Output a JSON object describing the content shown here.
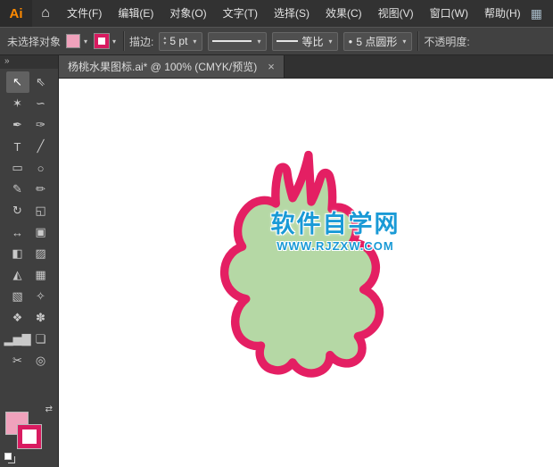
{
  "menubar": {
    "logo_text": "Ai",
    "home_icon": "⌂",
    "items": [
      {
        "name": "file",
        "label": "文件(F)"
      },
      {
        "name": "edit",
        "label": "编辑(E)"
      },
      {
        "name": "object",
        "label": "对象(O)"
      },
      {
        "name": "type",
        "label": "文字(T)"
      },
      {
        "name": "select",
        "label": "选择(S)"
      },
      {
        "name": "effect",
        "label": "效果(C)"
      },
      {
        "name": "view",
        "label": "视图(V)"
      },
      {
        "name": "window",
        "label": "窗口(W)"
      },
      {
        "name": "help",
        "label": "帮助(H)"
      }
    ],
    "panels_icon": "▦"
  },
  "controlbar": {
    "no_selection_label": "未选择对象",
    "fill_color": "#f0a2bc",
    "stroke_color": "#d81b60",
    "chevron_icon": "▾",
    "stroke_label": "描边:",
    "stepper_up_icon": "▴",
    "stepper_down_icon": "▾",
    "stroke_weight_value": "5 pt",
    "width_profile_value": "等比",
    "brush_dot_icon": "●",
    "brush_value": "5 点圆形",
    "opacity_label": "不透明度:"
  },
  "tabbar": {
    "title": "杨桃水果图标.ai* @ 100% (CMYK/预览)",
    "close_icon": "×"
  },
  "toolbar": {
    "collapse_icon": "»",
    "swap_icon": "⇄",
    "fill_color": "#f0a2bc",
    "stroke_color": "#d81b60",
    "tools": [
      {
        "name": "selection-tool",
        "glyph": "↖",
        "selected": true
      },
      {
        "name": "direct-selection-tool",
        "glyph": "⇖"
      },
      {
        "name": "magic-wand-tool",
        "glyph": "✶"
      },
      {
        "name": "lasso-tool",
        "glyph": "∽"
      },
      {
        "name": "pen-tool",
        "glyph": "✒"
      },
      {
        "name": "curvature-tool",
        "glyph": "✑"
      },
      {
        "name": "type-tool",
        "glyph": "T"
      },
      {
        "name": "line-segment-tool",
        "glyph": "╱"
      },
      {
        "name": "rectangle-tool",
        "glyph": "▭"
      },
      {
        "name": "ellipse-tool",
        "glyph": "○"
      },
      {
        "name": "paintbrush-tool",
        "glyph": "✎"
      },
      {
        "name": "pencil-tool",
        "glyph": "✏"
      },
      {
        "name": "rotate-tool",
        "glyph": "↻"
      },
      {
        "name": "scale-tool",
        "glyph": "◱"
      },
      {
        "name": "width-tool",
        "glyph": "↔"
      },
      {
        "name": "free-transform-tool",
        "glyph": "▣"
      },
      {
        "name": "shape-builder-tool",
        "glyph": "◧"
      },
      {
        "name": "live-paint-bucket-tool",
        "glyph": "▨"
      },
      {
        "name": "perspective-grid-tool",
        "glyph": "◭"
      },
      {
        "name": "mesh-tool",
        "glyph": "▦"
      },
      {
        "name": "gradient-tool",
        "glyph": "▧"
      },
      {
        "name": "eyedropper-tool",
        "glyph": "✧"
      },
      {
        "name": "blend-tool",
        "glyph": "❖"
      },
      {
        "name": "symbol-sprayer-tool",
        "glyph": "✽"
      },
      {
        "name": "column-graph-tool",
        "glyph": "▂▅▇"
      },
      {
        "name": "artboard-tool",
        "glyph": "❏"
      },
      {
        "name": "slice-tool",
        "glyph": "✂"
      },
      {
        "name": "zoom-tool",
        "glyph": "◎"
      }
    ]
  },
  "canvas": {
    "artwork": {
      "fill_color": "#b5d8a5",
      "stroke_color": "#e41f63"
    },
    "watermark": {
      "title": "软件自学网",
      "url": "WWW.RJZXW.COM",
      "color": "#1a9ad6"
    }
  }
}
